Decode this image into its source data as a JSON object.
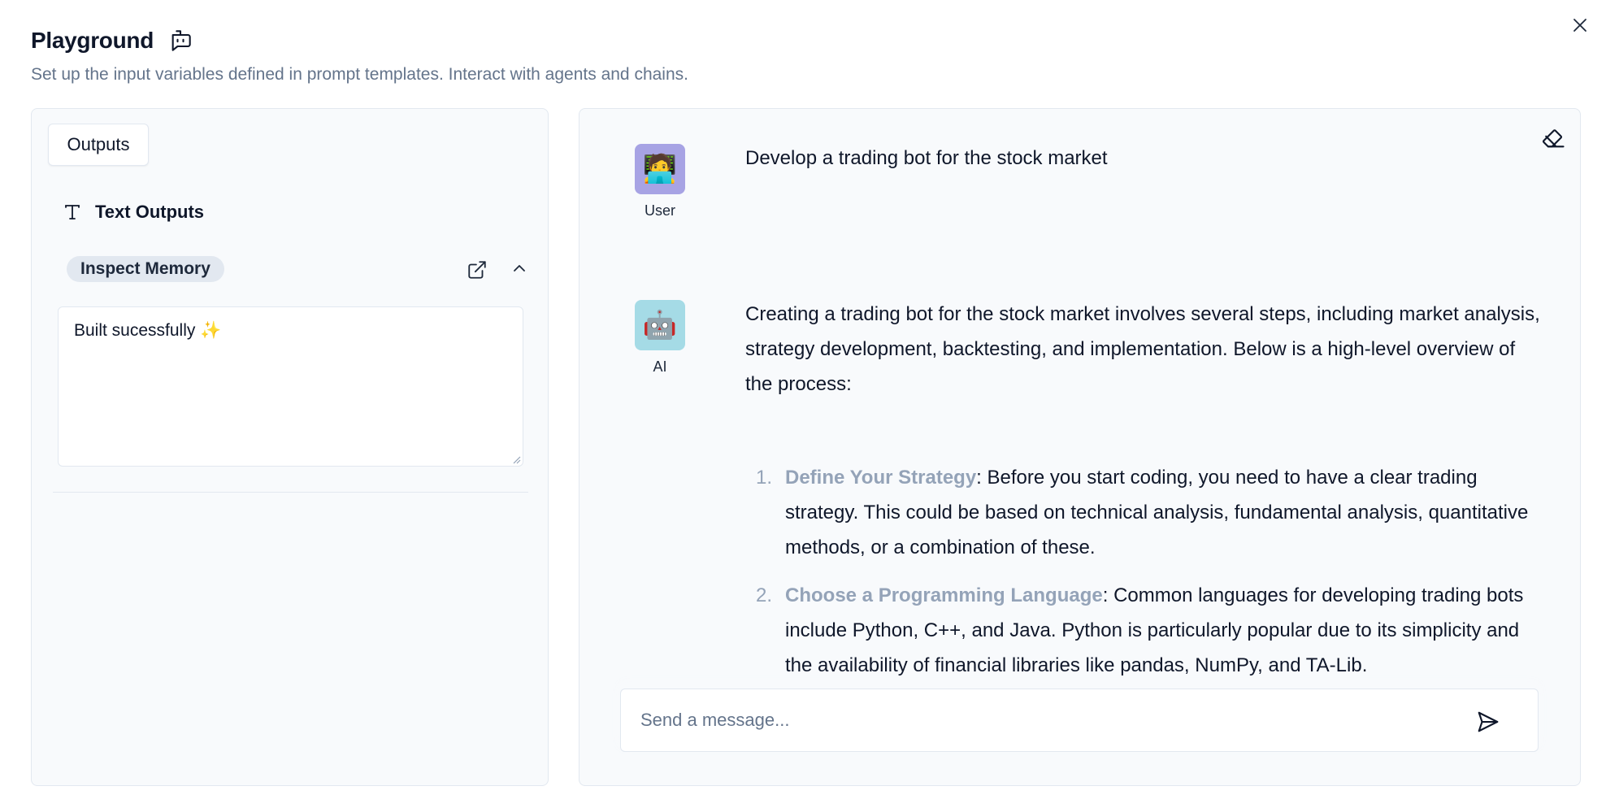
{
  "header": {
    "title": "Playground",
    "title_icon": "bot-message-icon",
    "subtitle": "Set up the input variables defined in prompt templates. Interact with agents and chains.",
    "close_icon": "close-icon"
  },
  "left_panel": {
    "tab_label": "Outputs",
    "section_icon": "text-type-icon",
    "section_label": "Text Outputs",
    "badge_label": "Inspect Memory",
    "open_icon": "external-link-icon",
    "collapse_icon": "chevron-up-icon",
    "output_value": "Built sucessfully ✨"
  },
  "chat": {
    "clear_icon": "eraser-icon",
    "messages": [
      {
        "role": "User",
        "avatar_emoji": "🧑‍💻",
        "avatar_color": "#a7a3e4",
        "text": "Develop a trading bot for the stock market"
      },
      {
        "role": "AI",
        "avatar_emoji": "🤖",
        "avatar_color": "#a5dbe6",
        "text": "Creating a trading bot for the stock market involves several steps, including market analysis, strategy development, backtesting, and implementation. Below is a high-level overview of the process:",
        "list": [
          {
            "num": "1.",
            "title": "Define Your Strategy",
            "body": ": Before you start coding, you need to have a clear trading strategy. This could be based on technical analysis, fundamental analysis, quantitative methods, or a combination of these."
          },
          {
            "num": "2.",
            "title": "Choose a Programming Language",
            "body": ": Common languages for developing trading bots include Python, C++, and Java. Python is particularly popular due to its simplicity and the availability of financial libraries like pandas, NumPy, and TA-Lib."
          }
        ]
      }
    ],
    "composer": {
      "placeholder": "Send a message...",
      "send_icon": "send-icon"
    }
  },
  "colors": {
    "panel_bg": "#f8fafc",
    "border": "#e2e8f0",
    "muted_text": "#64748b",
    "list_highlight": "#94a3b8"
  }
}
